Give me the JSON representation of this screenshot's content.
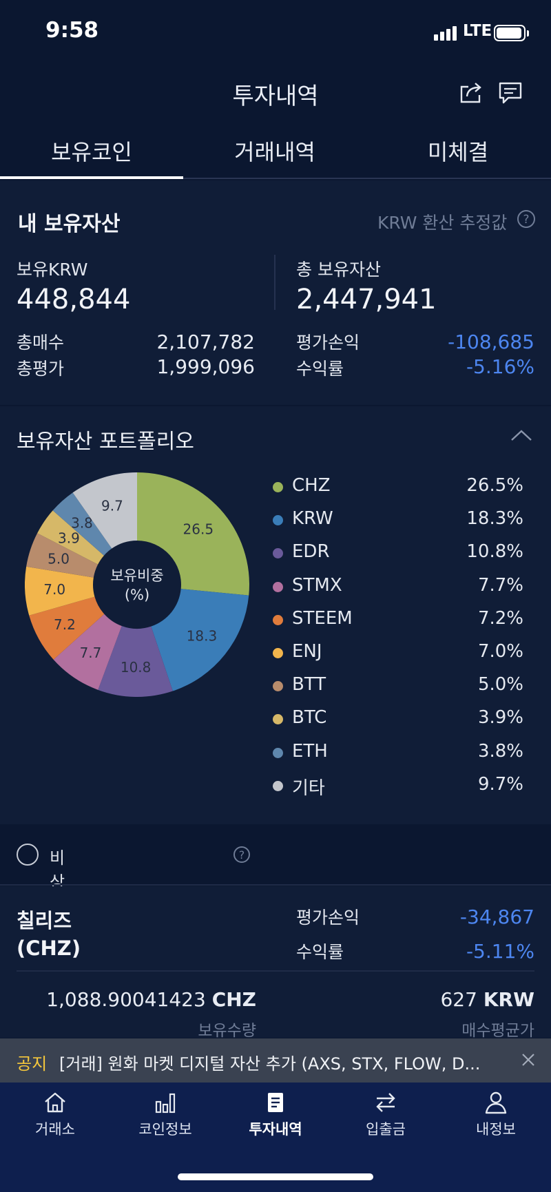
{
  "status_bar": {
    "time": "9:58",
    "network": "LTE"
  },
  "header": {
    "title": "투자내역"
  },
  "tabs": [
    "보유코인",
    "거래내역",
    "미체결"
  ],
  "assets": {
    "title": "내 보유자산",
    "krw_note": "KRW 환산 추정값",
    "held_krw_label": "보유KRW",
    "held_krw_value": "448,844",
    "total_label": "총 보유자산",
    "total_value": "2,447,941",
    "buy_label": "총매수",
    "buy_value": "2,107,782",
    "eval_label": "총평가",
    "eval_value": "1,999,096",
    "pl_label": "평가손익",
    "pl_value": "-108,685",
    "rate_label": "수익률",
    "rate_value": "-5.16%"
  },
  "portfolio": {
    "title": "보유자산 포트폴리오",
    "center_label_1": "보유비중",
    "center_label_2": "(%)"
  },
  "chart_data": {
    "type": "pie",
    "categories": [
      "CHZ",
      "KRW",
      "EDR",
      "STMX",
      "STEEM",
      "ENJ",
      "BTT",
      "BTC",
      "ETH",
      "기타"
    ],
    "values": [
      26.5,
      18.3,
      10.8,
      7.7,
      7.2,
      7.0,
      5.0,
      3.9,
      3.8,
      9.7
    ],
    "slice_labels": [
      "26.5",
      "18.3",
      "10.8",
      "7.7",
      "7.2",
      "7.0",
      "5.0",
      "3.9",
      "3.8",
      "9.7"
    ],
    "legend_pcts": [
      "26.5%",
      "18.3%",
      "10.8%",
      "7.7%",
      "7.2%",
      "7.0%",
      "5.0%",
      "3.9%",
      "3.8%",
      "9.7%"
    ],
    "colors": [
      "#9ab35a",
      "#3a7db8",
      "#6a5a9a",
      "#b2709f",
      "#e07c3c",
      "#f2b54c",
      "#b88c6c",
      "#d6b868",
      "#5f87ad",
      "#c3c6cc"
    ],
    "legend_placement": "right"
  },
  "hide_toggle": {
    "label": "비상장/소액 코인 숨기기"
  },
  "coin": {
    "name_line1": "칠리즈",
    "name_line2": "(CHZ)",
    "pl_label": "평가손익",
    "pl_value": "-34,867",
    "rate_label": "수익률",
    "rate_value": "-5.11%",
    "qty_value": "1,088.90041423",
    "qty_unit": "CHZ",
    "qty_label": "보유수량",
    "avg_value": "627",
    "avg_unit": "KRW",
    "avg_label": "매수평균가"
  },
  "notice": {
    "tag": "공지",
    "text": "[거래] 원화 마켓 디지털 자산 추가 (AXS, STX, FLOW, D..."
  },
  "nav": [
    {
      "label": "거래소",
      "icon": "home-icon"
    },
    {
      "label": "코인정보",
      "icon": "bar-chart-icon"
    },
    {
      "label": "투자내역",
      "icon": "document-icon"
    },
    {
      "label": "입출금",
      "icon": "transfer-icon"
    },
    {
      "label": "내정보",
      "icon": "person-icon"
    }
  ]
}
